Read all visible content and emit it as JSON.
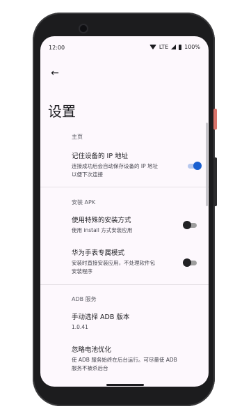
{
  "status": {
    "time": "12:00",
    "network": "LTE",
    "battery": "100%"
  },
  "header": {
    "title": "设置"
  },
  "sections": [
    {
      "label": "主页",
      "items": [
        {
          "title": "记住设备的 IP 地址",
          "subtitle": "连接成功后会自动保存设备的 IP 地址\n以便下次连接",
          "switch": "on"
        }
      ]
    },
    {
      "label": "安装 APK",
      "items": [
        {
          "title": "使用特殊的安装方式",
          "subtitle": "使用 install 方式安装应用",
          "switch": "off"
        },
        {
          "title": "华为手表专属模式",
          "subtitle": "安装时直接安装应用，不处理软件包\n安装程序",
          "switch": "off"
        }
      ]
    },
    {
      "label": "ADB 服务",
      "items": [
        {
          "title": "手动选择 ADB 版本",
          "subtitle": "1.0.41"
        },
        {
          "title": "忽略电池优化",
          "subtitle": "使 ADB 服务始终在后台运行。可尽量使 ADB\n服务不被杀后台"
        }
      ]
    }
  ],
  "colors": {
    "accent": "#1a5fd0",
    "background": "#fdf8fd"
  }
}
